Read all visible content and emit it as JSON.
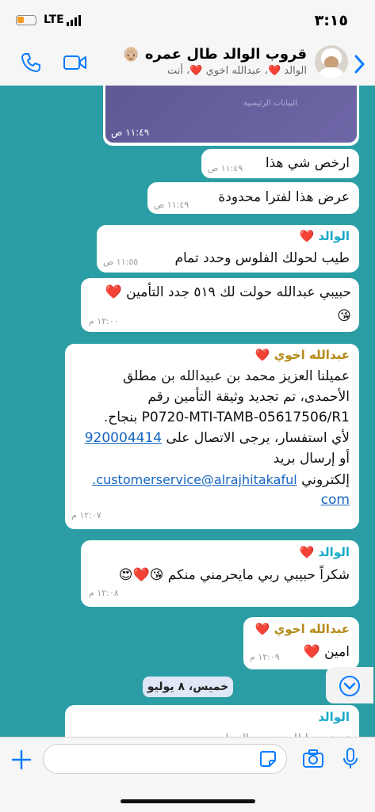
{
  "status": {
    "carrier": "LTE",
    "time": "٣:١٥"
  },
  "header": {
    "title": "قروب الوالد طال عمره 👴🏼",
    "subtitle": "الوالد ❤️، عبدالله اخوي ❤️، أنت"
  },
  "messages": [
    {
      "id": "m0",
      "time": "١١:٤٩ ص",
      "image_caption": "البيانات الرئيسية"
    },
    {
      "id": "m1",
      "text": "ارخص شي هذا",
      "time": "١١:٤٩ ص"
    },
    {
      "id": "m2",
      "text": "عرض هذا لفترا محدودة",
      "time": "١١:٤٩ ص"
    },
    {
      "id": "m3",
      "sender": "الوالد ❤️",
      "text": "طيب لحولك الفلوس وحدد تمام",
      "time": "١١:٥٥ ص"
    },
    {
      "id": "m4",
      "line1": "حبيبي عبدالله حولت لك ٥١٩ جدد التأمين ❤️",
      "line2": "😘",
      "time": "١٢:٠٠ م"
    },
    {
      "id": "m5",
      "sender": "عبدالله اخوي ❤️",
      "line1": "عميلنا العزيز محمد بن عبيدالله بن مطلق",
      "line2": "الأحمدى، تم تجديد وثيقة التأمين  رقم",
      "line3": "P0720-MTI-TAMB-05617506/R1 بنجاح.",
      "line4a": "لأي استفسار، يرجى الاتصال على ",
      "phone": "920004414",
      "line5": "أو إرسال بريد",
      "line6a": "إلكتروني ",
      "email1": "customerservice@alrajhitakaful.",
      "email2": "com",
      "time": "١٢:٠٧ م"
    },
    {
      "id": "m6",
      "sender": "الوالد ❤️",
      "text": "شكراً حبيبي ربي مايحرمني منكم 😘❤️😍",
      "time": "١٢:٠٨ م"
    },
    {
      "id": "m7",
      "sender": "عبدالله اخوي ❤️",
      "text": "امين ❤️",
      "time": "١٢:٠٩ م"
    },
    {
      "id": "m8",
      "sender": "الوالد",
      "text": "تم تجديها للعديد من المرات"
    }
  ],
  "date_chip": "خميس، ٨ يوليو",
  "colors": {
    "accent": "#0a7cff",
    "chat_bg": "#2b9ea5",
    "sender_father": "#19a9c8",
    "sender_brother": "#b58a16"
  }
}
